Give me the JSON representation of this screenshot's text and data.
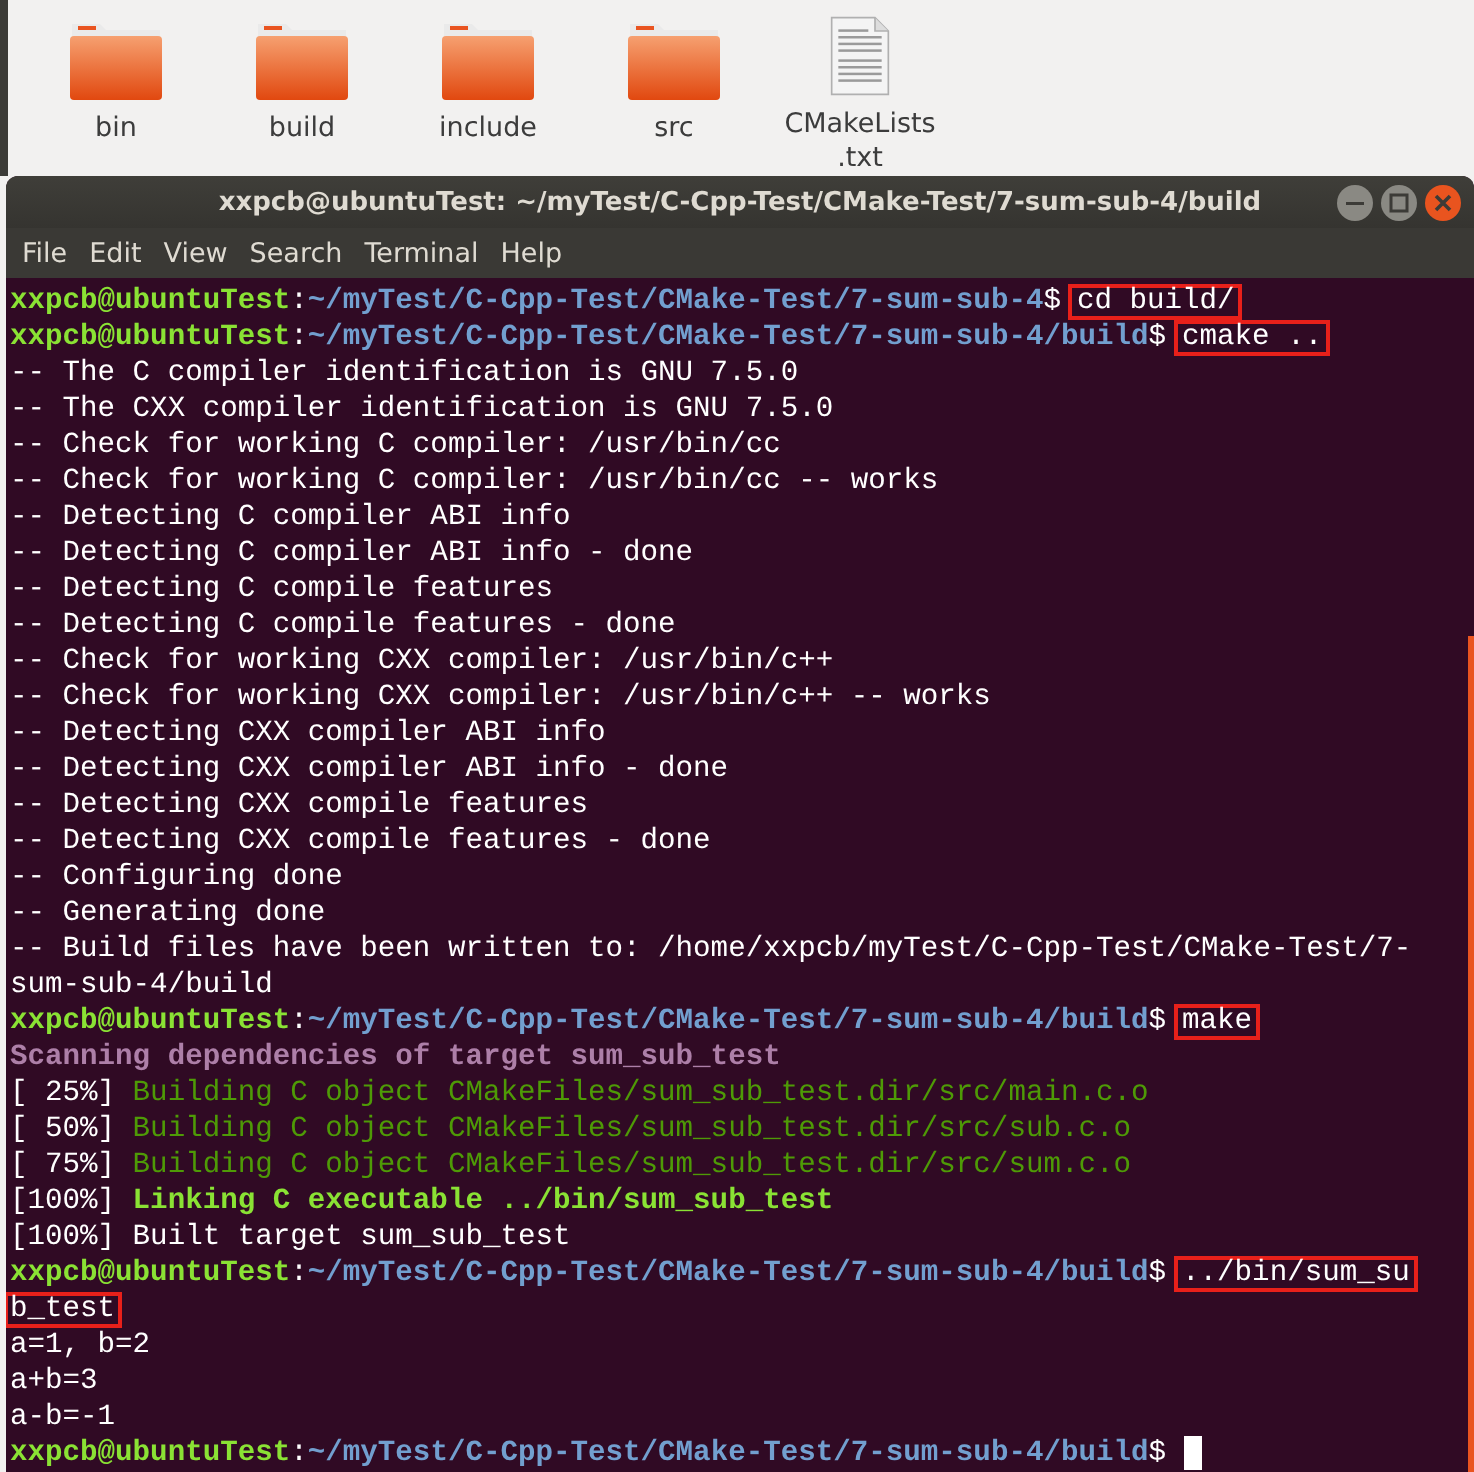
{
  "files": [
    {
      "name": "bin",
      "kind": "folder"
    },
    {
      "name": "build",
      "kind": "folder"
    },
    {
      "name": "include",
      "kind": "folder"
    },
    {
      "name": "src",
      "kind": "folder"
    },
    {
      "name": "CMakeLists\n.txt",
      "kind": "text"
    }
  ],
  "terminal": {
    "title": "xxpcb@ubuntuTest: ~/myTest/C-Cpp-Test/CMake-Test/7-sum-sub-4/build",
    "menu": [
      "File",
      "Edit",
      "View",
      "Search",
      "Terminal",
      "Help"
    ],
    "lines": [
      {
        "kind": "prompt",
        "user": "xxpcb@ubuntuTest",
        "separator": ":",
        "path": "~/myTest/C-Cpp-Test/CMake-Test/7-sum-sub-4",
        "sign": "$",
        "command": "cd build/",
        "boxed": true
      },
      {
        "kind": "prompt",
        "user": "xxpcb@ubuntuTest",
        "separator": ":",
        "path": "~/myTest/C-Cpp-Test/CMake-Test/7-sum-sub-4/build",
        "sign": "$",
        "command": "cmake ..",
        "boxed": true
      },
      {
        "kind": "output",
        "text": "-- The C compiler identification is GNU 7.5.0"
      },
      {
        "kind": "output",
        "text": "-- The CXX compiler identification is GNU 7.5.0"
      },
      {
        "kind": "output",
        "text": "-- Check for working C compiler: /usr/bin/cc"
      },
      {
        "kind": "output",
        "text": "-- Check for working C compiler: /usr/bin/cc -- works"
      },
      {
        "kind": "output",
        "text": "-- Detecting C compiler ABI info"
      },
      {
        "kind": "output",
        "text": "-- Detecting C compiler ABI info - done"
      },
      {
        "kind": "output",
        "text": "-- Detecting C compile features"
      },
      {
        "kind": "output",
        "text": "-- Detecting C compile features - done"
      },
      {
        "kind": "output",
        "text": "-- Check for working CXX compiler: /usr/bin/c++"
      },
      {
        "kind": "output",
        "text": "-- Check for working CXX compiler: /usr/bin/c++ -- works"
      },
      {
        "kind": "output",
        "text": "-- Detecting CXX compiler ABI info"
      },
      {
        "kind": "output",
        "text": "-- Detecting CXX compiler ABI info - done"
      },
      {
        "kind": "output",
        "text": "-- Detecting CXX compile features"
      },
      {
        "kind": "output",
        "text": "-- Detecting CXX compile features - done"
      },
      {
        "kind": "output",
        "text": "-- Configuring done"
      },
      {
        "kind": "output",
        "text": "-- Generating done"
      },
      {
        "kind": "output",
        "text": "-- Build files have been written to: /home/xxpcb/myTest/C-Cpp-Test/CMake-Test/7-"
      },
      {
        "kind": "output",
        "text": "sum-sub-4/build"
      },
      {
        "kind": "prompt",
        "user": "xxpcb@ubuntuTest",
        "separator": ":",
        "path": "~/myTest/C-Cpp-Test/CMake-Test/7-sum-sub-4/build",
        "sign": "$",
        "command": "make",
        "boxed": true
      },
      {
        "kind": "scanning",
        "text": "Scanning dependencies of target sum_sub_test"
      },
      {
        "kind": "building",
        "percent": "[ 25%]",
        "text": "Building C object CMakeFiles/sum_sub_test.dir/src/main.c.o"
      },
      {
        "kind": "building",
        "percent": "[ 50%]",
        "text": "Building C object CMakeFiles/sum_sub_test.dir/src/sub.c.o"
      },
      {
        "kind": "building",
        "percent": "[ 75%]",
        "text": "Building C object CMakeFiles/sum_sub_test.dir/src/sum.c.o"
      },
      {
        "kind": "linking",
        "percent": "[100%]",
        "text": "Linking C executable ../bin/sum_sub_test"
      },
      {
        "kind": "output",
        "text": "[100%] Built target sum_sub_test"
      },
      {
        "kind": "prompt",
        "user": "xxpcb@ubuntuTest",
        "separator": ":",
        "path": "~/myTest/C-Cpp-Test/CMake-Test/7-sum-sub-4/build",
        "sign": "$",
        "command": "../bin/sum_su",
        "boxed": true
      },
      {
        "kind": "output",
        "text": "b_test",
        "boxed": true
      },
      {
        "kind": "output",
        "text": "a=1, b=2"
      },
      {
        "kind": "output",
        "text": "a+b=3"
      },
      {
        "kind": "output",
        "text": "a-b=-1"
      },
      {
        "kind": "prompt",
        "user": "xxpcb@ubuntuTest",
        "separator": ":",
        "path": "~/myTest/C-Cpp-Test/CMake-Test/7-sum-sub-4/build",
        "sign": "$",
        "cursor": true
      }
    ]
  }
}
